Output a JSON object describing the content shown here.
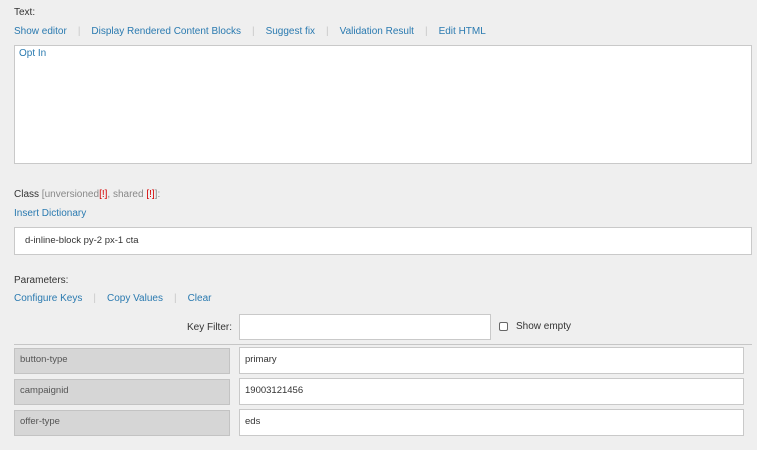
{
  "text_section": {
    "label": "Text:",
    "toolbar": [
      "Show editor",
      "Display Rendered Content Blocks",
      "Suggest fix",
      "Validation Result",
      "Edit HTML"
    ],
    "content": "Opt In"
  },
  "class_section": {
    "label": "Class",
    "unversioned_text": "[unversioned",
    "unversioned_flag": "[!]",
    "shared_text": ", shared",
    "shared_flag": "[!]",
    "suffix": "]:",
    "insert_link": "Insert Dictionary",
    "value": "d-inline-block py-2 px-1 cta"
  },
  "parameters": {
    "label": "Parameters:",
    "toolbar": [
      "Configure Keys",
      "Copy Values",
      "Clear"
    ],
    "key_filter_label": "Key Filter:",
    "key_filter_value": "",
    "show_empty_label": "Show empty",
    "rows": [
      {
        "key": "button-type",
        "value": "primary"
      },
      {
        "key": "campaignid",
        "value": "19003121456"
      },
      {
        "key": "offer-type",
        "value": "eds"
      }
    ]
  }
}
